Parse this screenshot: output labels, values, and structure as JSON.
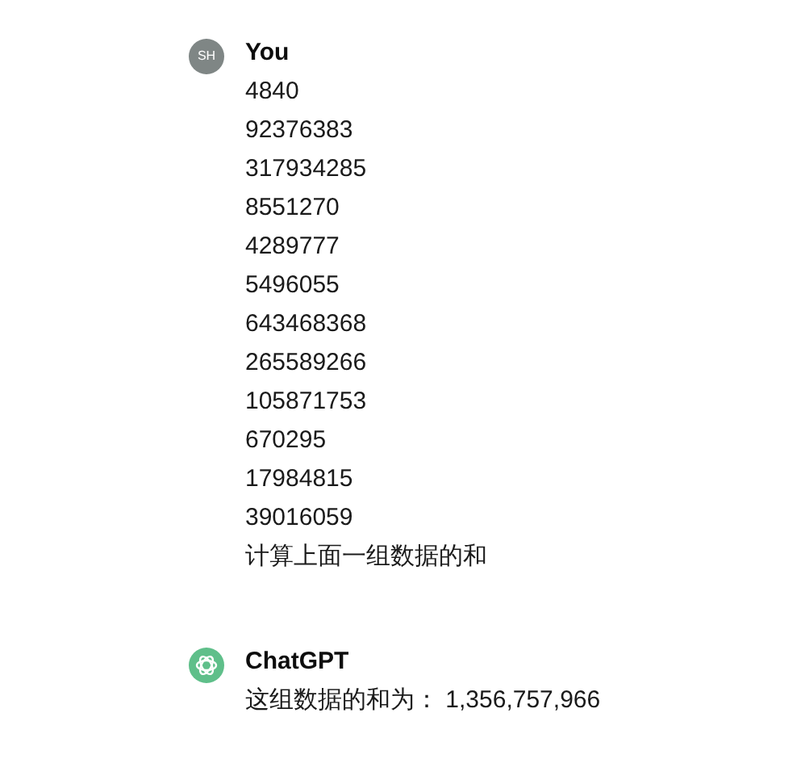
{
  "messages": [
    {
      "kind": "user",
      "avatar": "SH",
      "author": "You",
      "lines": [
        "4840",
        "92376383",
        "317934285",
        "8551270",
        "4289777",
        "5496055",
        "643468368",
        "265589266",
        "105871753",
        "670295",
        "17984815",
        "39016059",
        "计算上面一组数据的和"
      ]
    },
    {
      "kind": "assistant",
      "author": "ChatGPT",
      "lines": [
        "这组数据的和为： 1,356,757,966"
      ]
    }
  ]
}
